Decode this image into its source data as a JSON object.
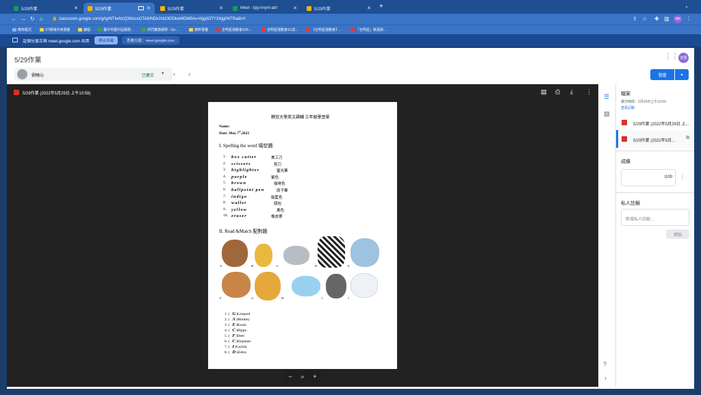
{
  "tabs": [
    {
      "label": "5/29作業",
      "active": false
    },
    {
      "label": "5/29作業",
      "active": true
    },
    {
      "label": "5/29作業",
      "active": false
    },
    {
      "label": "Meet - tpg-nnym-abf",
      "active": false
    },
    {
      "label": "5/29作業",
      "active": false
    }
  ],
  "address": {
    "url": "classroom.google.com/g/tg/NTIwNzQ3MzcxOTA5/NDk1NzI3ODkwMDM5#u=Njg3OTY1Njg0NTRa&t=f"
  },
  "bookmarks": [
    "應用程式",
    "ST網域共用書籤",
    "課程",
    "臺中市國中區服務...",
    "共同實施硬碟 - Go...",
    "康軒書櫃",
    "全明星運動會S2E...",
    "全明星運動會S1成...",
    "【全明星運動會】...",
    "「全明星」跳遠破..."
  ],
  "meet_bar": {
    "message": "這個分頁正與 meet.google.com 共用",
    "stop_label": "停止共用",
    "view_label": "查看分頁：meet.google.com"
  },
  "classroom": {
    "title": "5/29作業",
    "student_name": "劉曉沁",
    "status": "已繳交",
    "return_label": "發還"
  },
  "viewer": {
    "file_title": "5/29作業 (2022年5月29日 上午10:59)",
    "zoom_minus": "−",
    "zoom_plus": "+"
  },
  "worksheet": {
    "heading": "靜宜大學英文課輔 三年級學習單",
    "name_label": "Name:",
    "date_label": "Date: May 7",
    "date_sup": "th",
    "date_year": ",2022",
    "section1_title": "I. Spelling the word 填空題",
    "spelling": [
      {
        "num": "1.",
        "word": "box cutter",
        "zh": "美工刀"
      },
      {
        "num": "2.",
        "word": "scissors",
        "zh": "剪刀"
      },
      {
        "num": "3.",
        "word": "highlighter",
        "zh": "螢光筆"
      },
      {
        "num": "4.",
        "word": "purple",
        "zh": "紫色"
      },
      {
        "num": "5.",
        "word": "brown",
        "zh": "咖啡色"
      },
      {
        "num": "6.",
        "word": "ballpoint pen",
        "zh": "原子筆"
      },
      {
        "num": "7.",
        "word": "indigo",
        "zh": "靛藍色"
      },
      {
        "num": "8.",
        "word": "wallet",
        "zh": "錢包"
      },
      {
        "num": "9.",
        "word": "yellow",
        "zh": "黃色"
      },
      {
        "num": "10.",
        "word": "eraser",
        "zh": "橡皮擦"
      }
    ],
    "section2_title": "II. Read &Match 配對題",
    "picture_letters": [
      "A",
      "B",
      "C",
      "D",
      "E",
      "F",
      "G",
      "H",
      "I",
      "J"
    ],
    "matching": [
      {
        "num": "1.",
        "answer": "G",
        "word": ")Leopard"
      },
      {
        "num": "2.",
        "answer": "A",
        "word": ")Monkey"
      },
      {
        "num": "3.",
        "answer": "E",
        "word": ")Koala"
      },
      {
        "num": "4.",
        "answer": "C",
        "word": ")Hippo"
      },
      {
        "num": "5.",
        "answer": "F",
        "word": ")Deer"
      },
      {
        "num": "6.",
        "answer": "C",
        "word": ")Elephant"
      },
      {
        "num": "7.",
        "answer": "I",
        "word": ")Gorilla"
      },
      {
        "num": "8.",
        "answer": "D",
        "word": ")Zebra"
      }
    ]
  },
  "side": {
    "files_heading": "檔案",
    "submitted_time": "繳交時間：5月29日上午10:59",
    "history_link": "查看記錄",
    "files": [
      "5/29作業 (2022年5月29日 上...",
      "5/29作業 (2022年5月..."
    ],
    "grade_heading": "成績",
    "grade_total": "/100",
    "notes_heading": "私人註解",
    "notes_placeholder": "新增私人註解...",
    "post_label": "張貼"
  },
  "colors": {
    "accent": "#1a73e8",
    "chrome": "#3a74c6",
    "file_red": "#d93025"
  }
}
